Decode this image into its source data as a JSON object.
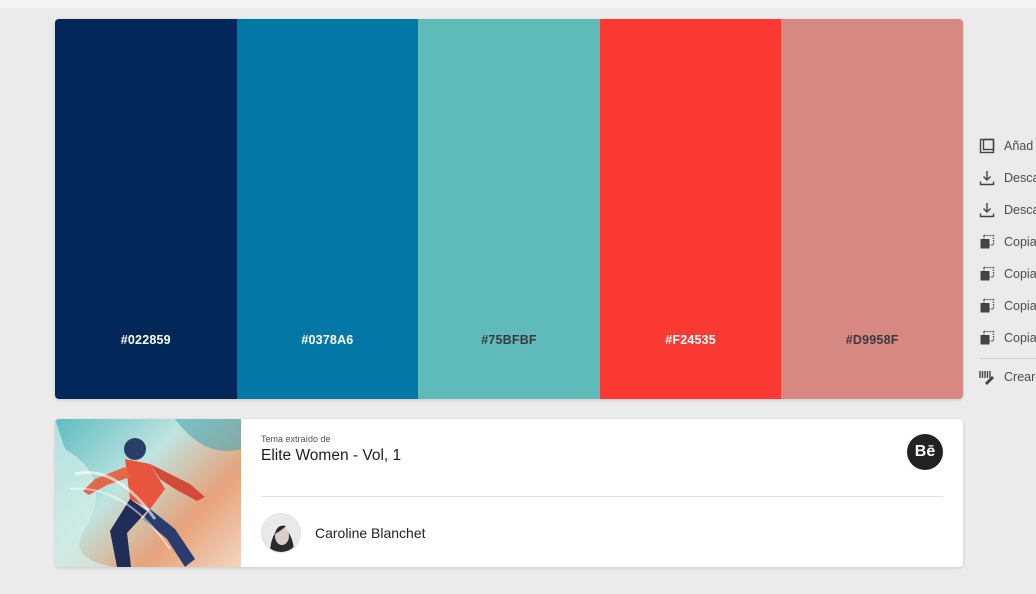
{
  "palette": {
    "swatches": [
      {
        "hex": "#022859",
        "label": "#022859",
        "text_tone": "light"
      },
      {
        "hex": "#0378A6",
        "label": "#0378A6",
        "text_tone": "light"
      },
      {
        "hex": "#5FBABA",
        "label": "#75BFBF",
        "text_tone": "dark"
      },
      {
        "hex": "#FC3A34",
        "label": "#F24535",
        "text_tone": "light"
      },
      {
        "hex": "#D88883",
        "label": "#D9958F",
        "text_tone": "dark"
      }
    ]
  },
  "side_menu": {
    "items": [
      {
        "label": "Añad",
        "icon": "library-add-icon"
      },
      {
        "label": "Desca",
        "icon": "download-icon"
      },
      {
        "label": "Desca",
        "icon": "download-icon"
      },
      {
        "label": "Copia",
        "icon": "copy-icon"
      },
      {
        "label": "Copia",
        "icon": "copy-icon"
      },
      {
        "label": "Copia",
        "icon": "copy-icon"
      },
      {
        "label": "Copia",
        "icon": "copy-icon"
      }
    ],
    "create_label": "Crear",
    "create_icon": "create-brush-icon"
  },
  "source_card": {
    "extracted_label": "Tema extraído de",
    "title": "Elite Women - Vol, 1",
    "behance_label": "Bē",
    "author_name": "Caroline Blanchet"
  }
}
